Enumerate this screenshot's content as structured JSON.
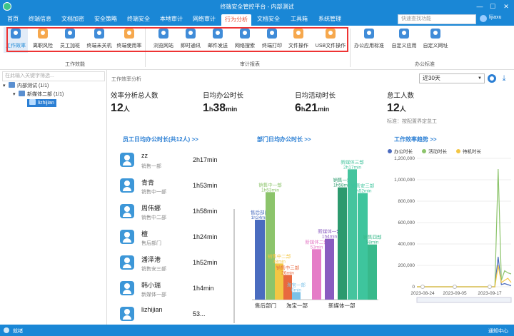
{
  "window": {
    "title": "终端安全管控平台 - 内部测试",
    "minimize": "—",
    "maximize": "☐",
    "close": "✕"
  },
  "menu": {
    "items": [
      "首页",
      "终端信息",
      "文档加密",
      "安全策略",
      "终端安全",
      "本地审计",
      "网络审计",
      "行为分析",
      "文档安全",
      "工具箱",
      "系统管理"
    ],
    "active_index": 7,
    "search_placeholder": "快速查找功能",
    "user": "lijiaxu"
  },
  "ribbon": {
    "items": [
      {
        "label": "工作效率",
        "icon": "work-efficiency-chart-icon",
        "selected": true
      },
      {
        "label": "离职风险",
        "icon": "resign-risk-user-icon"
      },
      {
        "label": "员工加班",
        "icon": "overtime-user-icon"
      },
      {
        "label": "终端未关机",
        "icon": "not-shutdown-monitor-icon"
      },
      {
        "label": "终端使用率",
        "icon": "usage-pie-icon"
      },
      {
        "label": "浏览网站",
        "icon": "globe-icon"
      },
      {
        "label": "即时通讯",
        "icon": "phone-icon"
      },
      {
        "label": "邮件发送",
        "icon": "mail-icon"
      },
      {
        "label": "网络搜索",
        "icon": "search-globe-icon"
      },
      {
        "label": "终端打印",
        "icon": "printer-icon"
      },
      {
        "label": "文件操作",
        "icon": "file-icon"
      },
      {
        "label": "USB文件操作",
        "icon": "usb-folder-icon"
      },
      {
        "label": "办公应用标准",
        "icon": "app-standard-icon"
      },
      {
        "label": "自定义应用",
        "icon": "custom-app-icon"
      },
      {
        "label": "自定义网址",
        "icon": "custom-url-icon"
      }
    ],
    "groups": [
      "工作效能",
      "审计报表",
      "办公标准"
    ]
  },
  "tree": {
    "filter_placeholder": "在此输入关键字筛选...",
    "nodes": [
      "内部测试 (1/1)",
      "新媒体二部 (1/1)",
      "lizhijian"
    ]
  },
  "main": {
    "header": "工作效率分析",
    "range": "近30天",
    "metrics": [
      {
        "label": "效率分析总人数",
        "value": "12",
        "unit": "人"
      },
      {
        "label": "日均办公时长",
        "h": "1",
        "m": "38"
      },
      {
        "label": "日均活动时长",
        "h": "6",
        "m": "21"
      },
      {
        "label": "怠工人数",
        "value": "12",
        "unit": "人",
        "note": "标准：按配置界定怠工"
      }
    ],
    "h_unit": "h",
    "m_unit": "min",
    "sections": [
      "员工日均办公时长(共12人) >>",
      "部门日均办公时长 >>",
      "工作效率趋势 >>"
    ],
    "employees": [
      {
        "name": "zz",
        "dept": "销售一部",
        "time": "2h17min"
      },
      {
        "name": "青青",
        "dept": "销售中一部",
        "time": "1h53min"
      },
      {
        "name": "周伟娜",
        "dept": "销售中二部",
        "time": "1h58min"
      },
      {
        "name": "檀",
        "dept": "售后部门",
        "time": "1h24min"
      },
      {
        "name": "潘泽港",
        "dept": "销售安三部",
        "time": "1h52min"
      },
      {
        "name": "韩小瑞",
        "dept": "新媒体一部",
        "time": "1h4min"
      },
      {
        "name": "lizhijian",
        "dept": "",
        "time": "53..."
      }
    ]
  },
  "chart_data": [
    {
      "type": "bar",
      "title": "部门日均办公时长",
      "categories": [
        "售后部门",
        "销售中一部",
        "销售中二部",
        "销售中三部",
        "淘宝一部",
        "新媒体二部",
        "新媒体一部",
        "销售一部",
        "新媒体三部",
        "销售安三部",
        "销售四部"
      ],
      "values": [
        84,
        113,
        38,
        26,
        8,
        53,
        64,
        118,
        137,
        112,
        58
      ],
      "value_labels": [
        "1h24min",
        "1h53min",
        "38min",
        "26min",
        "8min",
        "53min",
        "1h4min",
        "1h58min",
        "2h17min",
        "1h52min",
        "58min"
      ],
      "colors": [
        "#4a6cbf",
        "#8cc46b",
        "#f3c644",
        "#e8693f",
        "#7cc2e8",
        "#e57cc7",
        "#8a5cc0",
        "#2c9a6e",
        "#45c49e",
        "#3ec59d",
        "#38b98b"
      ],
      "xtick_labels": [
        "售后部门",
        "淘宝一部",
        "新媒体一部"
      ]
    },
    {
      "type": "line",
      "title": "工作效率趋势",
      "series": [
        {
          "name": "办公时长",
          "color": "#4b6bbf",
          "values": [
            0,
            0,
            0,
            0,
            0,
            0,
            0,
            0,
            0,
            0,
            0,
            0,
            0,
            0,
            0,
            0,
            0,
            0,
            0,
            0,
            0,
            0,
            0,
            0,
            0,
            280000,
            20000,
            30000,
            20000,
            10000
          ]
        },
        {
          "name": "活动时长",
          "color": "#8cc46b",
          "values": [
            0,
            0,
            0,
            0,
            0,
            0,
            0,
            0,
            0,
            0,
            0,
            0,
            0,
            0,
            0,
            0,
            0,
            0,
            0,
            0,
            0,
            0,
            0,
            0,
            0,
            1100000,
            60000,
            150000,
            130000,
            120000
          ]
        },
        {
          "name": "待机时长",
          "color": "#f3c644",
          "values": [
            0,
            0,
            0,
            0,
            0,
            0,
            0,
            0,
            0,
            0,
            0,
            0,
            0,
            0,
            0,
            0,
            0,
            0,
            0,
            0,
            0,
            0,
            0,
            0,
            0,
            200000,
            40000,
            60000,
            80000,
            40000
          ]
        }
      ],
      "x_labels": [
        "2023-08-24",
        "2023-09-05",
        "2023-09-17"
      ],
      "y_ticks": [
        "0",
        "200,000",
        "400,000",
        "600,000",
        "800,000",
        "1,000,000",
        "1,200,000"
      ],
      "ylim": [
        0,
        1200000
      ]
    }
  ],
  "status": {
    "left": "就绪",
    "right": "通知中心"
  }
}
